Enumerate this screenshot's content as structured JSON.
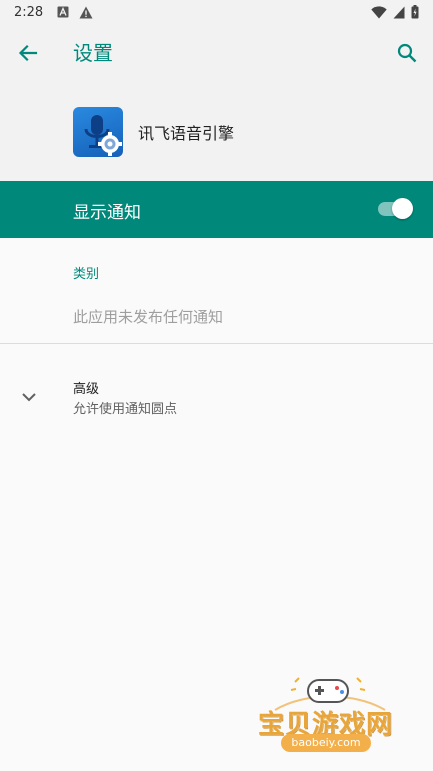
{
  "status_bar": {
    "time": "2:28",
    "icons": [
      "a-box-icon",
      "warning-icon",
      "wifi-icon",
      "signal-icon",
      "battery-icon"
    ]
  },
  "app_bar": {
    "title": "设置",
    "back_icon": "arrow-left-icon",
    "search_icon": "search-icon"
  },
  "app_header": {
    "app_name": "讯飞语音引擎",
    "icon": "microphone-gear-icon"
  },
  "master_switch": {
    "label": "显示通知",
    "checked": true
  },
  "category": {
    "title": "类别",
    "empty_text": "此应用未发布任何通知"
  },
  "advanced": {
    "title": "高级",
    "summary": "允许使用通知圆点",
    "icon": "chevron-down-icon"
  },
  "watermark": {
    "title": "宝贝游戏网",
    "url": "baobeiy.com"
  },
  "colors": {
    "accent": "#00897b",
    "background": "#fafafa",
    "header_background": "#f2f2f2"
  }
}
